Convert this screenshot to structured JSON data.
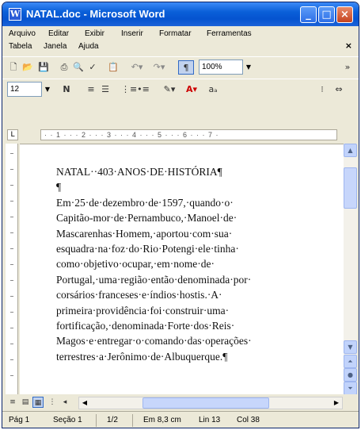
{
  "window": {
    "title": "NATAL.doc - Microsoft Word"
  },
  "menu": {
    "row1": [
      "Arquivo",
      "Editar",
      "Exibir",
      "Inserir",
      "Formatar",
      "Ferramentas"
    ],
    "row2": [
      "Tabela",
      "Janela",
      "Ajuda"
    ]
  },
  "toolbar": {
    "zoom": "100%",
    "font_size": "12"
  },
  "ruler": {
    "marks": "· · 1 · · · 2 · · · 3 · · · 4 · · · 5 · · · 6 · · · 7 ·"
  },
  "document": {
    "lines": [
      "NATAL··403·ANOS·DE·HISTÓRIA¶",
      "¶",
      "Em·25·de·dezembro·de·1597,·quando·o·",
      "Capitão-mor·de·Pernambuco,·Manoel·de·",
      "Mascarenhas·Homem,·aportou·com·sua·",
      "esquadra·na·foz·do·Rio·Potengi·ele·tinha·",
      "como·objetivo·ocupar,·em·nome·de·",
      "Portugal,·uma·região·então·denominada·por·",
      "corsários·franceses·e·índios·hostis.·A·",
      "primeira·providência·foi·construir·uma·",
      "fortificação,·denominada·Forte·dos·Reis·",
      "Magos·e·entregar·o·comando·das·operações·",
      "terrestres·a·Jerônimo·de·Albuquerque.¶"
    ]
  },
  "status": {
    "page": "Pág 1",
    "section": "Seção 1",
    "pages": "1/2",
    "position": "Em 8,3 cm",
    "line": "Lin 13",
    "column": "Col 38"
  }
}
